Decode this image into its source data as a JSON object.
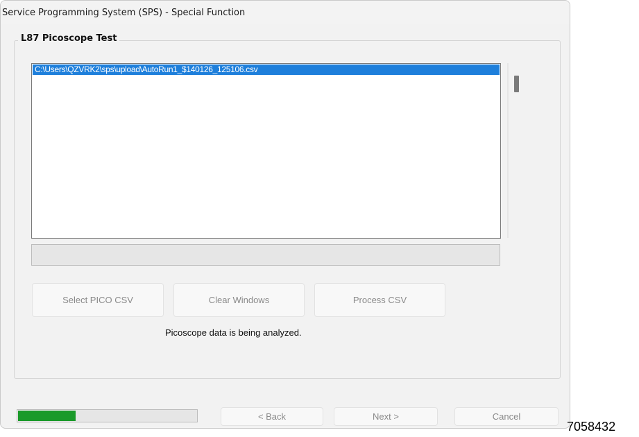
{
  "window": {
    "title": "Service Programming System (SPS) - Special Function"
  },
  "group": {
    "title": "L87 Picoscope Test"
  },
  "file_list": {
    "items": [
      "C:\\Users\\QZVRK2\\sps\\upload\\AutoRun1_$140126_125106.csv"
    ],
    "selected_index": 0
  },
  "status_box": {
    "text": ""
  },
  "actions": {
    "select_label": "Select PICO CSV",
    "clear_label": "Clear Windows",
    "process_label": "Process CSV"
  },
  "message": "Picoscope data is being analyzed.",
  "progress": {
    "value": 0.33
  },
  "nav": {
    "back_label": "< Back",
    "next_label": "Next >",
    "cancel_label": "Cancel"
  },
  "figure_id": "7058432",
  "colors": {
    "selection": "#1e7fdb",
    "progress_fill": "#1a9a2a",
    "disabled_text": "#8a8a8a"
  }
}
